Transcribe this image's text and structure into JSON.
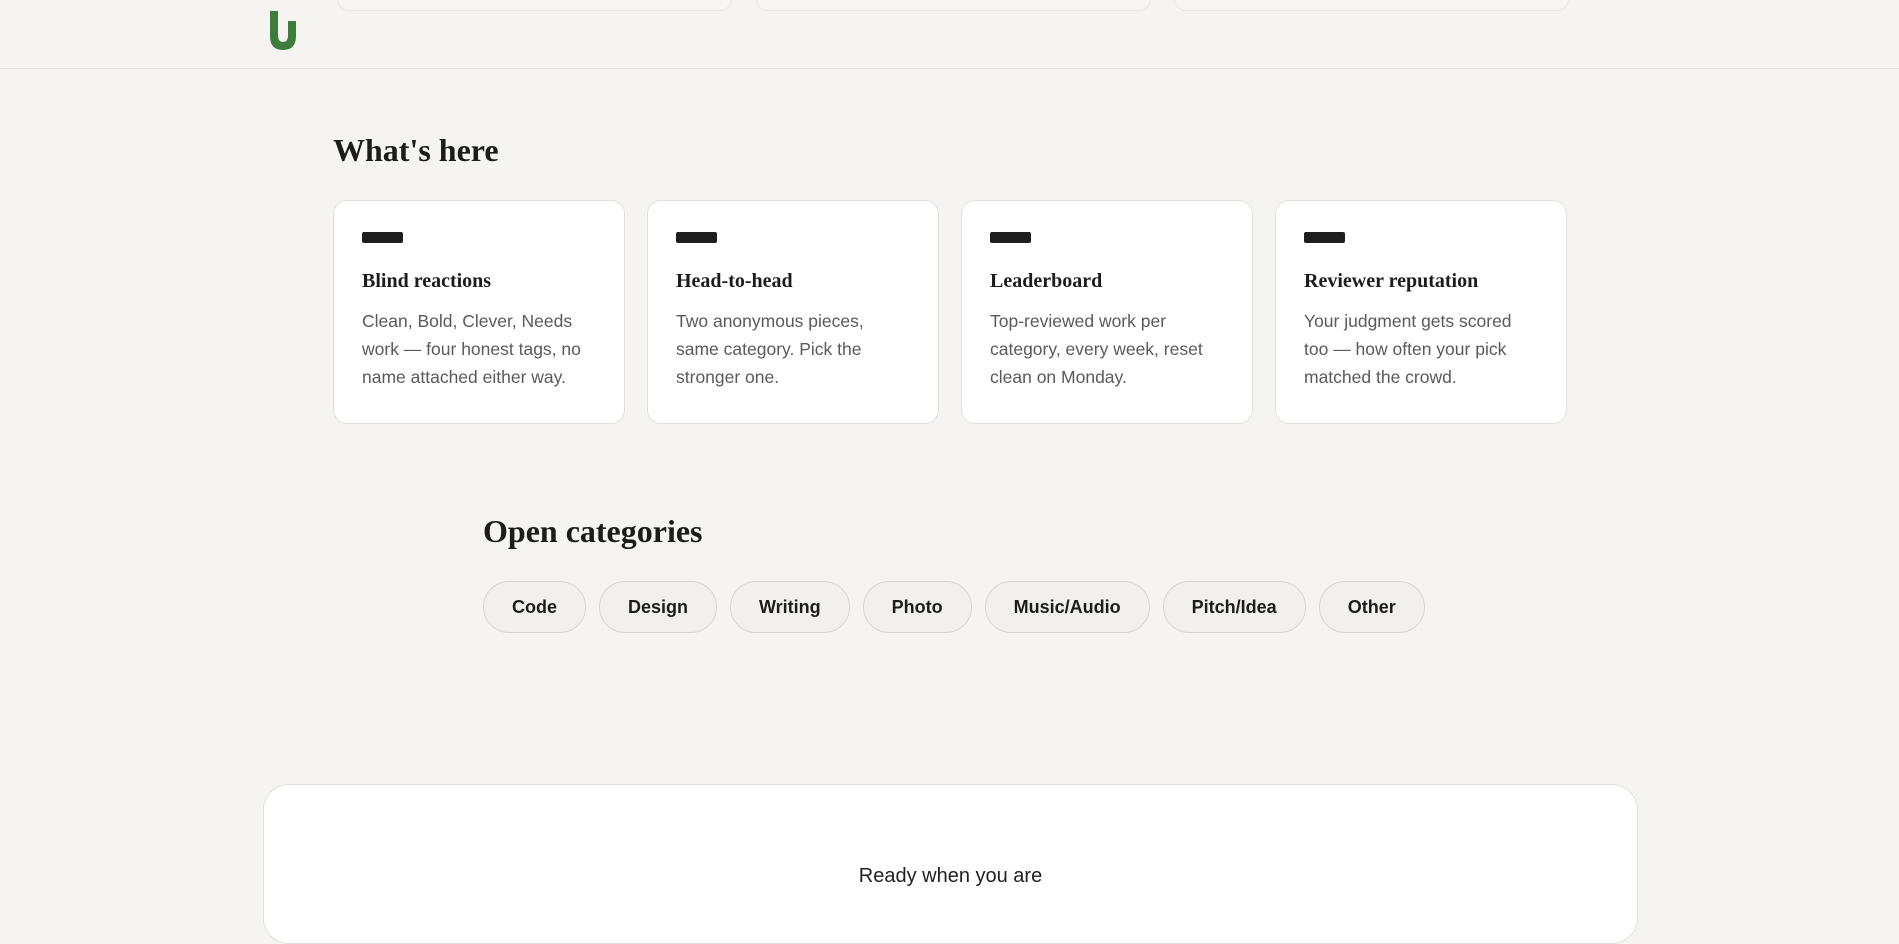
{
  "header": {
    "logo_icon": "u-logo-icon",
    "accent_color": "#3d7d3c"
  },
  "whats_here": {
    "title": "What's here",
    "cards": [
      {
        "icon": "bar-icon",
        "title": "Blind reactions",
        "desc": "Clean, Bold, Clever, Needs work — four honest tags, no name attached either way."
      },
      {
        "icon": "bar-icon",
        "title": "Head-to-head",
        "desc": "Two anonymous pieces, same category. Pick the stronger one."
      },
      {
        "icon": "bar-icon",
        "title": "Leaderboard",
        "desc": "Top-reviewed work per category, every week, reset clean on Monday."
      },
      {
        "icon": "bar-icon",
        "title": "Reviewer reputation",
        "desc": "Your judgment gets scored too — how often your pick matched the crowd."
      }
    ]
  },
  "categories": {
    "title": "Open categories",
    "items": [
      "Code",
      "Design",
      "Writing",
      "Photo",
      "Music/Audio",
      "Pitch/Idea",
      "Other"
    ]
  },
  "cta": {
    "text": "Ready when you are"
  }
}
